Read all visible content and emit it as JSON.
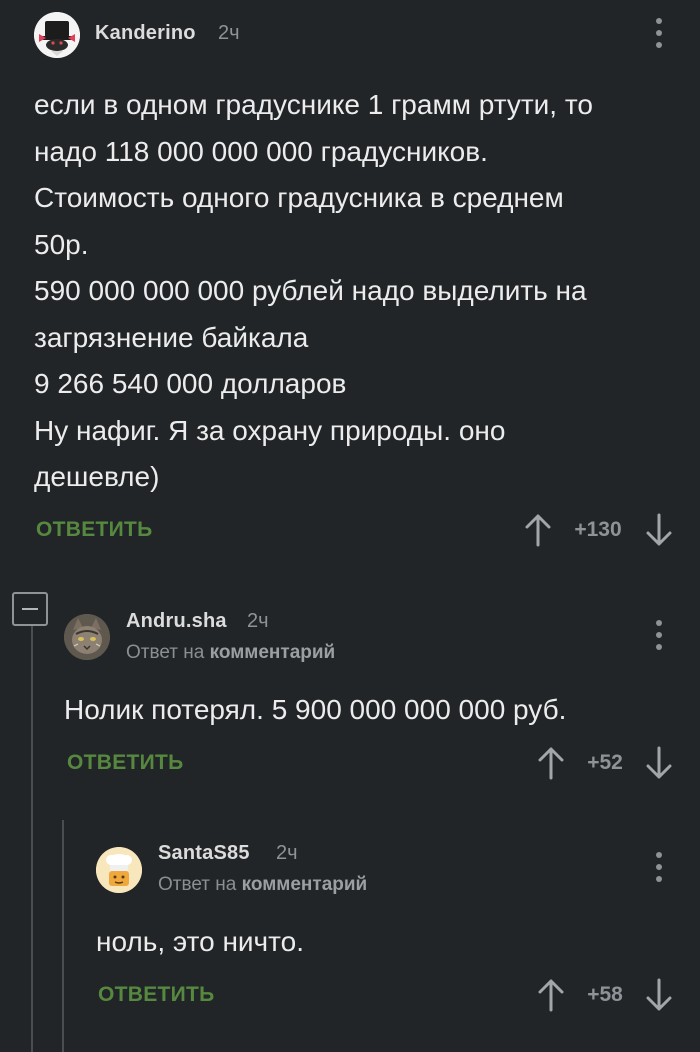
{
  "comments": [
    {
      "author": "Kanderino",
      "time": "2ч",
      "text": "если в одном градуснике 1 грамм ртути, то\nнадо 118 000 000 000 градусников.\nСтоимость одного градусника в среднем\n50р.\n590 000 000 000 рублей надо выделить на\nзагрязнение байкала\n9 266 540 000 долларов\nНу нафиг. Я за охрану природы. оно\nдешевле)",
      "reply_label": "ОТВЕТИТЬ",
      "rating": "+130",
      "icons": {
        "up": "arrow-up-icon",
        "down": "arrow-down-icon",
        "menu": "more-vertical-icon"
      }
    },
    {
      "author": "Andru.sha",
      "time": "2ч",
      "reply_prefix": "Ответ на",
      "reply_target": "комментарий",
      "text": "Нолик потерял. 5 900 000 000 000 руб.",
      "reply_label": "ОТВЕТИТЬ",
      "rating": "+52"
    },
    {
      "author": "SantaS85",
      "time": "2ч",
      "reply_prefix": "Ответ на",
      "reply_target": "комментарий",
      "text": "ноль, это ничто.",
      "reply_label": "ОТВЕТИТЬ",
      "rating": "+58"
    }
  ],
  "colors": {
    "background": "#222527",
    "text": "#ececec",
    "muted": "#8e9397",
    "reply_green": "#56893f",
    "thread_line": "#4a4e51"
  }
}
